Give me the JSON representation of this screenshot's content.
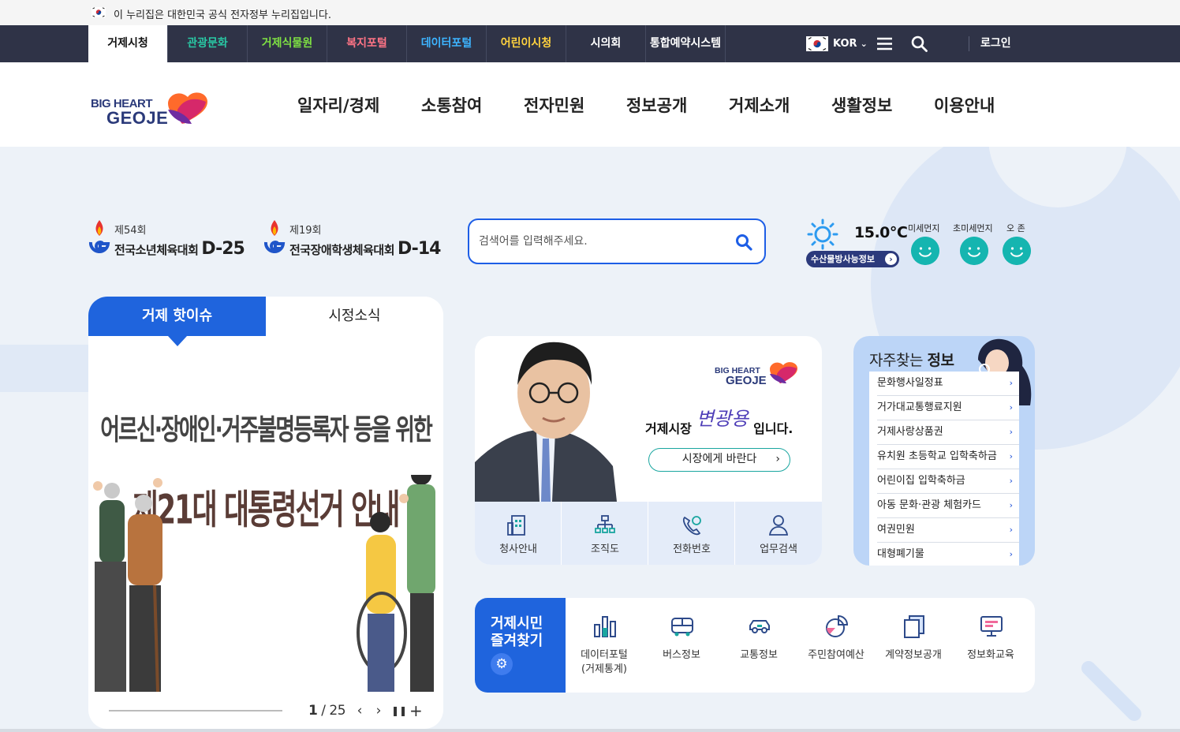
{
  "notice": {
    "text": "이 누리집은 대한민국 공식 전자정부 누리집입니다."
  },
  "topnav": {
    "sites": [
      {
        "label": "거제시청",
        "color": "#111111"
      },
      {
        "label": "관광문화",
        "color": "#29c8a4"
      },
      {
        "label": "거제식물원",
        "color": "#7ee043"
      },
      {
        "label": "복지포털",
        "color": "#ff7486"
      },
      {
        "label": "데이터포털",
        "color": "#3db4ff"
      },
      {
        "label": "어린이시청",
        "color": "#ffd23e"
      },
      {
        "label": "시의회",
        "color": "#ffffff"
      },
      {
        "label": "통합예약시스템",
        "color": "#ffffff"
      }
    ],
    "lang": "KOR",
    "login": "로그인"
  },
  "header": {
    "menu": [
      "일자리/경제",
      "소통참여",
      "전자민원",
      "정보공개",
      "거제소개",
      "생활정보",
      "이용안내"
    ]
  },
  "events": [
    {
      "round": "제54회",
      "name": "전국소년체육대회",
      "dday": "D-25"
    },
    {
      "round": "제19회",
      "name": "전국장애학생체육대회",
      "dday": "D-14"
    }
  ],
  "search": {
    "placeholder": "검색어를 입력해주세요."
  },
  "weather": {
    "temp": "15.0℃",
    "seafood": "수산물방사능정보",
    "air": [
      "미세먼지",
      "초미세먼지",
      "오 존"
    ],
    "face_color": "#15b5b0"
  },
  "issues": {
    "tabs": [
      "거제 핫이슈",
      "시정소식"
    ],
    "banner_line1": "어르신·장애인·거주불명등록자 등을 위한",
    "banner_line2": "제21대 대통령선거 안내",
    "current": "1",
    "total": "/ 25"
  },
  "mayor": {
    "prefix": "거제시장",
    "name": "변광용",
    "suffix": "입니다.",
    "button": "시장에게 바란다",
    "quick": [
      "청사안내",
      "조직도",
      "전화번호",
      "업무검색"
    ]
  },
  "faq": {
    "title_normal": "자주찾는",
    "title_bold": "정보",
    "items": [
      "문화행사일정표",
      "거가대교통행료지원",
      "거제사랑상품권",
      "유치원 초등학교 입학축하금",
      "어린이집 입학축하금",
      "아동 문화·관광 체험카드",
      "여권민원",
      "대형폐기물"
    ]
  },
  "favorites": {
    "title1": "거제시민",
    "title2": "즐겨찾기",
    "items": [
      "데이터포털\n(거제통계)",
      "버스정보",
      "교통정보",
      "주민참여예산",
      "계약정보공개",
      "정보화교육"
    ]
  },
  "colors": {
    "primary": "#1f64dd",
    "navy": "#2f3347",
    "accent": "#4f3fb8"
  }
}
